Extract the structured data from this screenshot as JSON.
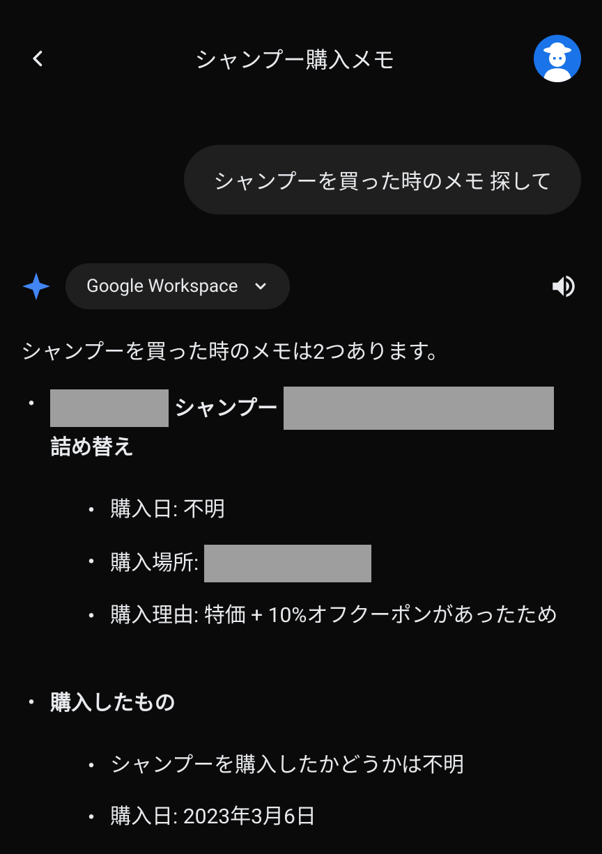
{
  "header": {
    "title": "シャンプー購入メモ"
  },
  "user_message": "シャンプーを買った時のメモ 探して",
  "workspace_chip": {
    "label": "Google Workspace"
  },
  "response": {
    "intro": "シャンプーを買った時のメモは2つあります。",
    "memos": [
      {
        "title_part_1": "シャンプー",
        "title_part_2": "詰め替え",
        "details": [
          {
            "label": "購入日",
            "value": "不明"
          },
          {
            "label": "購入場所",
            "value": ""
          },
          {
            "label": "購入理由",
            "value": "特価 + 10%オフクーポンがあったため"
          }
        ]
      },
      {
        "title": "購入したもの",
        "details": [
          {
            "text": "シャンプーを購入したかどうかは不明"
          },
          {
            "label": "購入日",
            "value": "2023年3月6日"
          }
        ]
      }
    ]
  }
}
